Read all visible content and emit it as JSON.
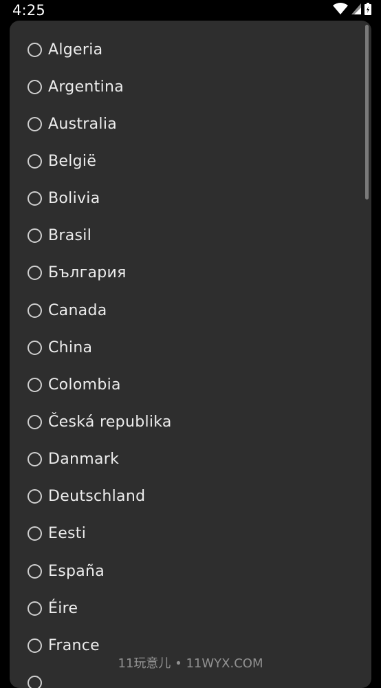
{
  "status_bar": {
    "time": "4:25",
    "icons": [
      "wifi-icon",
      "signal-icon",
      "battery-icon"
    ]
  },
  "dialog": {
    "countries": [
      {
        "label": "Algeria",
        "selected": false
      },
      {
        "label": "Argentina",
        "selected": false
      },
      {
        "label": "Australia",
        "selected": false
      },
      {
        "label": "België",
        "selected": false
      },
      {
        "label": "Bolivia",
        "selected": false
      },
      {
        "label": "Brasil",
        "selected": false
      },
      {
        "label": "България",
        "selected": false
      },
      {
        "label": "Canada",
        "selected": false
      },
      {
        "label": "China",
        "selected": false
      },
      {
        "label": "Colombia",
        "selected": false
      },
      {
        "label": "Česká republika",
        "selected": false
      },
      {
        "label": "Danmark",
        "selected": false
      },
      {
        "label": "Deutschland",
        "selected": false
      },
      {
        "label": "Eesti",
        "selected": false
      },
      {
        "label": "España",
        "selected": false
      },
      {
        "label": "Éire",
        "selected": false
      },
      {
        "label": "France",
        "selected": false
      },
      {
        "label": "",
        "selected": false
      }
    ]
  },
  "watermark": "11玩意儿 • 11WYX.COM",
  "colors": {
    "background": "#000000",
    "dialog": "#2e2e2e",
    "text": "#ececec",
    "radio": "#cfcfcf"
  }
}
